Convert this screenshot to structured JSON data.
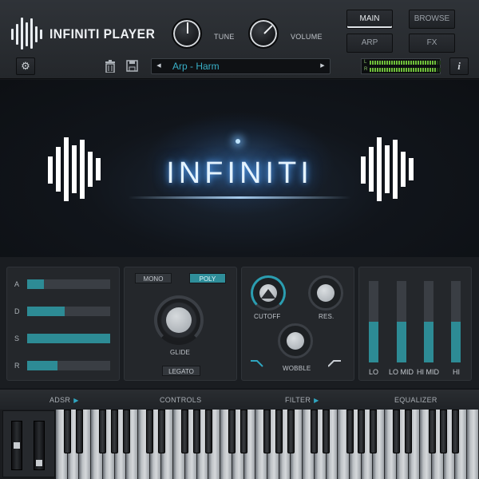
{
  "header": {
    "title": "INFINITI PLAYER",
    "knobs": [
      {
        "label": "TUNE"
      },
      {
        "label": "VOLUME"
      }
    ],
    "nav": {
      "main": "MAIN",
      "browse": "BROWSE",
      "arp": "ARP",
      "fx": "FX"
    },
    "preset_name": "Arp - Harm",
    "meter_l": "L",
    "meter_r": "R",
    "info": "i"
  },
  "hero": {
    "title": "INFINITI"
  },
  "adsr": {
    "items": [
      {
        "label": "A",
        "level": 0.2
      },
      {
        "label": "D",
        "level": 0.45
      },
      {
        "label": "S",
        "level": 1.0
      },
      {
        "label": "R",
        "level": 0.37
      }
    ]
  },
  "controls": {
    "mono": "MONO",
    "poly": "POLY",
    "glide": "GLIDE",
    "legato": "LEGATO"
  },
  "filter": {
    "cutoff": "CUTOFF",
    "res": "RES.",
    "wobble": "WOBBLE"
  },
  "equalizer": {
    "bands": [
      {
        "label": "LO",
        "level": 0.5
      },
      {
        "label": "LO MID",
        "level": 0.5
      },
      {
        "label": "HI MID",
        "level": 0.5
      },
      {
        "label": "HI",
        "level": 0.5
      }
    ]
  },
  "tabs": {
    "adsr": "ADSR",
    "controls": "CONTROLS",
    "filter": "FILTER",
    "equalizer": "EQUALIZER"
  },
  "colors": {
    "accent": "#2d8b95",
    "preset_text": "#39b0c8",
    "meter_green": "#6fbf3a"
  }
}
